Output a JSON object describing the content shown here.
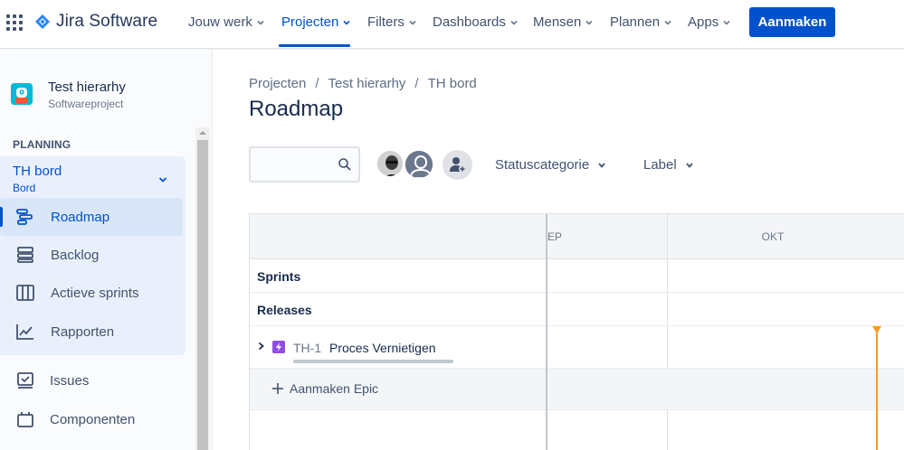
{
  "topnav": {
    "app_name": "Jira Software",
    "items": [
      {
        "label": "Jouw werk",
        "active": false
      },
      {
        "label": "Projecten",
        "active": true
      },
      {
        "label": "Filters",
        "active": false
      },
      {
        "label": "Dashboards",
        "active": false
      },
      {
        "label": "Mensen",
        "active": false
      },
      {
        "label": "Plannen",
        "active": false
      },
      {
        "label": "Apps",
        "active": false
      }
    ],
    "create_label": "Aanmaken",
    "accent_color": "#0052cc"
  },
  "sidebar": {
    "project_name": "Test hierarhy",
    "project_type": "Softwareproject",
    "section_label": "PLANNING",
    "board": {
      "title": "TH bord",
      "subtitle": "Bord"
    },
    "board_items": [
      {
        "label": "Roadmap",
        "icon": "roadmap-icon",
        "active": true
      },
      {
        "label": "Backlog",
        "icon": "backlog-icon",
        "active": false
      },
      {
        "label": "Actieve sprints",
        "icon": "board-columns-icon",
        "active": false
      },
      {
        "label": "Rapporten",
        "icon": "reports-chart-icon",
        "active": false
      }
    ],
    "other_items": [
      {
        "label": "Issues",
        "icon": "issues-icon"
      },
      {
        "label": "Componenten",
        "icon": "components-icon"
      }
    ]
  },
  "breadcrumb": [
    "Projecten",
    "Test hierarhy",
    "TH bord"
  ],
  "page_title": "Roadmap",
  "search": {
    "value": "",
    "placeholder": ""
  },
  "filters": {
    "status": "Statuscategorie",
    "label": "Label"
  },
  "roadmap": {
    "months": [
      "EP",
      "OKT"
    ],
    "rows": {
      "sprints": "Sprints",
      "releases": "Releases"
    },
    "epic": {
      "key": "TH-1",
      "name": "Proces Vernietigen",
      "icon_color": "#904ee2"
    },
    "create_epic_label": "Aanmaken Epic",
    "today_color": "#ff991f"
  }
}
